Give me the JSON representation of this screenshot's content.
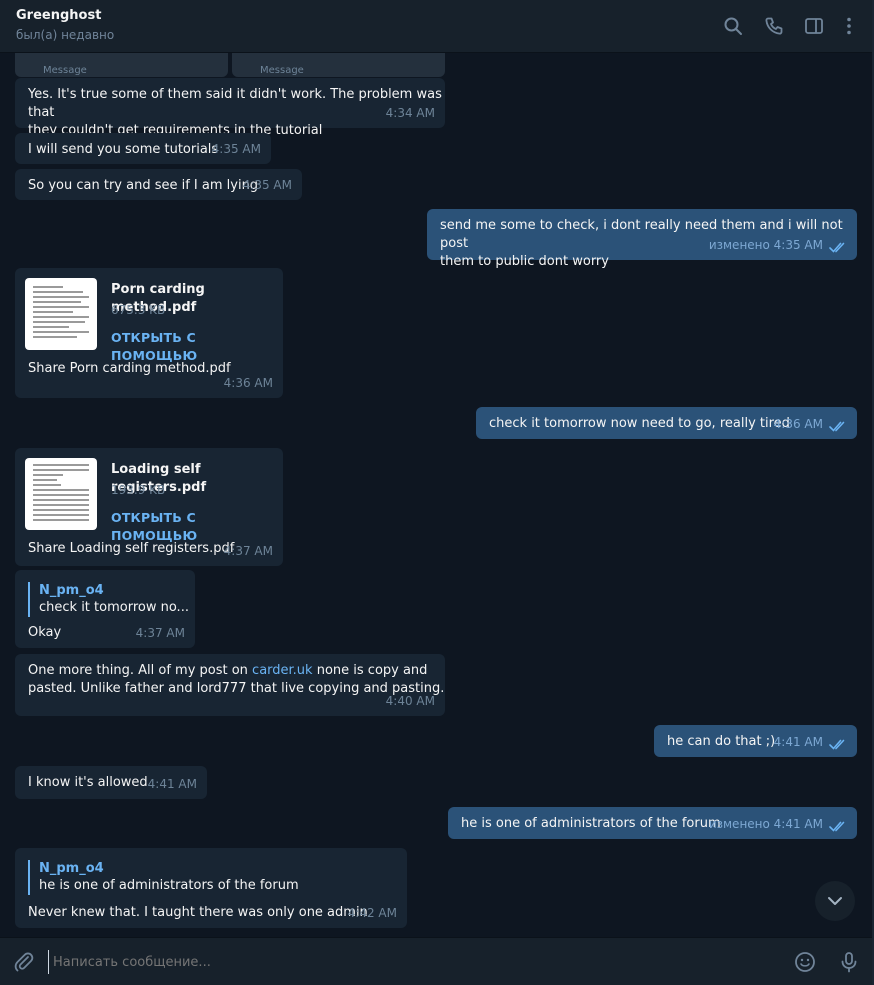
{
  "header": {
    "contact_name": "Greenghost",
    "contact_status": "был(а) недавно"
  },
  "top_remnant": {
    "left_label": "Message",
    "right_label": "Message"
  },
  "messages": [
    {
      "dir": "in",
      "text": "Yes. It's true some of them said it didn't work. The problem was that\nthey couldn't get requirements in the tutorial",
      "time": "4:34 AM"
    },
    {
      "dir": "in",
      "text": "I will send you some tutorials",
      "time": "4:35 AM"
    },
    {
      "dir": "in",
      "text": "So you can try and see if I am lying",
      "time": "4:35 AM"
    },
    {
      "dir": "out",
      "text": "send me some to check, i dont really need them and i will not post\nthem to public dont worry",
      "time": "изменено 4:35 AM"
    },
    {
      "dir": "in",
      "file_name": "Porn carding method.pdf",
      "file_size": "675.3 KB",
      "file_action": "ОТКРЫТЬ С ПОМОЩЬЮ",
      "caption": "Share Porn carding method.pdf",
      "time": "4:36 AM"
    },
    {
      "dir": "out",
      "text": "check it tomorrow now need to go, really tired",
      "time": "4:36 AM"
    },
    {
      "dir": "in",
      "file_name": "Loading self registers.pdf",
      "file_size": "193.9 KB",
      "file_action": "ОТКРЫТЬ С ПОМОЩЬЮ",
      "caption": "Share Loading self registers.pdf",
      "time": "4:37 AM"
    },
    {
      "dir": "in",
      "reply_name": "N_pm_o4",
      "reply_text": "check it tomorrow no...",
      "text": "Okay",
      "time": "4:37 AM"
    },
    {
      "dir": "in",
      "text_before": "One more thing. All of my post on ",
      "link": "carder.uk",
      "text_after": " none is copy and\npasted. Unlike father and lord777 that live copying and pasting.",
      "time": "4:40 AM"
    },
    {
      "dir": "out",
      "text": "he can do that ;)",
      "time": "4:41 AM"
    },
    {
      "dir": "in",
      "text": "I know it's allowed",
      "time": "4:41 AM"
    },
    {
      "dir": "out",
      "text": "he is one of administrators of the forum",
      "time": "изменено 4:41 AM"
    },
    {
      "dir": "in",
      "reply_name": "N_pm_o4",
      "reply_text": "he is one of administrators of the forum",
      "text": "Never knew that. I taught there was only one admin",
      "time": "4:42 AM"
    }
  ],
  "composer": {
    "placeholder": "Написать сообщение..."
  },
  "colors": {
    "background": "#0e1621",
    "incoming_bubble": "#182533",
    "outgoing_bubble": "#2b5278",
    "accent": "#6ab3f3",
    "header": "#17212b"
  }
}
